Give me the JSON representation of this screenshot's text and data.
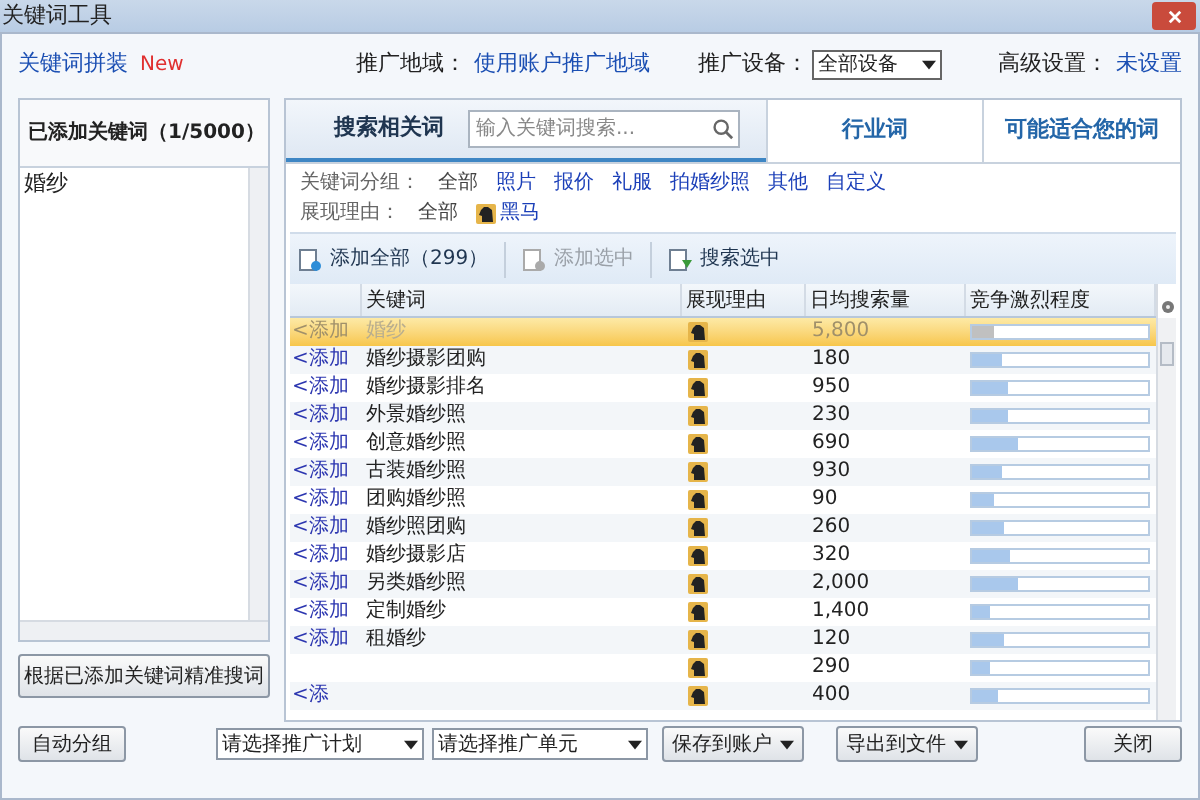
{
  "window": {
    "title": "关键词工具"
  },
  "header": {
    "link": "关键词拼装",
    "badge": "New",
    "region_label": "推广地域：",
    "region_value": "使用账户推广地域",
    "device_label": "推广设备：",
    "device_value": "全部设备",
    "advanced_label": "高级设置：",
    "advanced_value": "未设置"
  },
  "added_panel": {
    "title": "已添加关键词（1/5000）",
    "items": [
      "婚纱"
    ],
    "button": "根据已添加关键词精准搜词"
  },
  "tabs": [
    {
      "label": "搜索相关词",
      "selected": true,
      "search_placeholder": "输入关键词搜索..."
    },
    {
      "label": "行业词",
      "selected": false
    },
    {
      "label": "可能适合您的词",
      "selected": false
    }
  ],
  "filters": [
    {
      "label": "关键词分组：",
      "options": [
        {
          "label": "全部",
          "selected": true
        },
        {
          "label": "照片",
          "selected": false
        },
        {
          "label": "报价",
          "selected": false
        },
        {
          "label": "礼服",
          "selected": false
        },
        {
          "label": "拍婚纱照",
          "selected": false
        },
        {
          "label": "其他",
          "selected": false
        },
        {
          "label": "自定义",
          "selected": false
        }
      ]
    },
    {
      "label": "展现理由：",
      "options": [
        {
          "label": "全部",
          "selected": true
        },
        {
          "label": "黑马",
          "selected": false,
          "icon": true
        }
      ]
    }
  ],
  "toolbar": [
    {
      "label": "添加全部（299）",
      "disabled": false,
      "kind": "add"
    },
    {
      "label": "添加选中",
      "disabled": true,
      "kind": "add"
    },
    {
      "label": "搜索选中",
      "disabled": false,
      "kind": "search"
    }
  ],
  "table": {
    "columns": [
      "关键词",
      "展现理由",
      "日均搜索量",
      "竞争激烈程度"
    ],
    "rows": [
      {
        "add": "<添加",
        "keyword": "婚纱",
        "volume": "5,800",
        "level": 0.13,
        "selected": true
      },
      {
        "add": "<添加",
        "keyword": "婚纱摄影团购",
        "volume": "180",
        "level": 0.17,
        "selected": false
      },
      {
        "add": "<添加",
        "keyword": "婚纱摄影排名",
        "volume": "950",
        "level": 0.2,
        "selected": false
      },
      {
        "add": "<添加",
        "keyword": "外景婚纱照",
        "volume": "230",
        "level": 0.21,
        "selected": false
      },
      {
        "add": "<添加",
        "keyword": "创意婚纱照",
        "volume": "690",
        "level": 0.26,
        "selected": false
      },
      {
        "add": "<添加",
        "keyword": "古装婚纱照",
        "volume": "930",
        "level": 0.17,
        "selected": false
      },
      {
        "add": "<添加",
        "keyword": "团购婚纱照",
        "volume": "90",
        "level": 0.13,
        "selected": false
      },
      {
        "add": "<添加",
        "keyword": "婚纱照团购",
        "volume": "260",
        "level": 0.18,
        "selected": false
      },
      {
        "add": "<添加",
        "keyword": "婚纱摄影店",
        "volume": "320",
        "level": 0.22,
        "selected": false
      },
      {
        "add": "<添加",
        "keyword": "另类婚纱照",
        "volume": "2,000",
        "level": 0.26,
        "selected": false
      },
      {
        "add": "<添加",
        "keyword": "定制婚纱",
        "volume": "1,400",
        "level": 0.1,
        "selected": false
      },
      {
        "add": "<添加",
        "keyword": "租婚纱",
        "volume": "120",
        "level": 0.18,
        "selected": false
      },
      {
        "volume": "290",
        "level": 0.1,
        "selected": false
      },
      {
        "add": "<添",
        "volume": "400",
        "level": 0.15,
        "selected": false
      }
    ]
  },
  "footer": {
    "auto_group": "自动分组",
    "plan_select": "请选择推广计划",
    "unit_select": "请选择推广单元",
    "save": "保存到账户",
    "export": "导出到文件",
    "close": "关闭"
  }
}
